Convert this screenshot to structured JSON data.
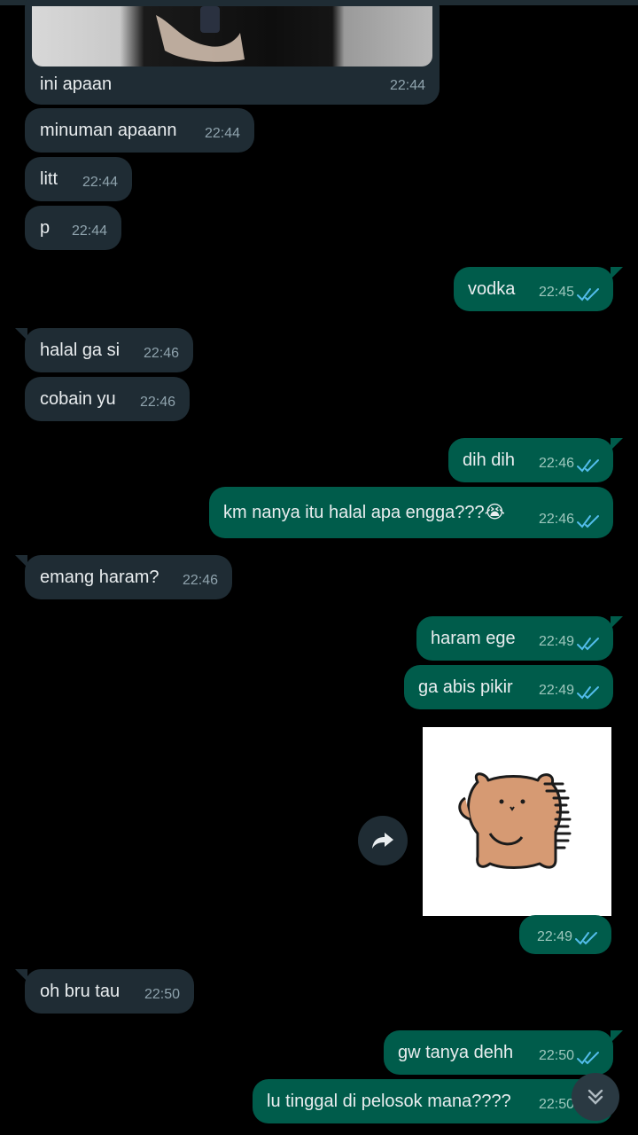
{
  "messages": [
    {
      "text": "ini apaan",
      "time": "22:44",
      "dir": "in"
    },
    {
      "text": "minuman apaann",
      "time": "22:44",
      "dir": "in"
    },
    {
      "text": "litt",
      "time": "22:44",
      "dir": "in"
    },
    {
      "text": "p",
      "time": "22:44",
      "dir": "in"
    },
    {
      "text": "vodka",
      "time": "22:45",
      "dir": "out"
    },
    {
      "text": "halal ga si",
      "time": "22:46",
      "dir": "in"
    },
    {
      "text": "cobain yu",
      "time": "22:46",
      "dir": "in"
    },
    {
      "text": "dih dih",
      "time": "22:46",
      "dir": "out"
    },
    {
      "text": "km nanya itu halal apa engga???😭",
      "time": "22:46",
      "dir": "out"
    },
    {
      "text": "emang haram?",
      "time": "22:46",
      "dir": "in"
    },
    {
      "text": "haram ege",
      "time": "22:49",
      "dir": "out"
    },
    {
      "text": "ga abis pikir",
      "time": "22:49",
      "dir": "out"
    },
    {
      "text": "",
      "time": "22:49",
      "dir": "out"
    },
    {
      "text": "oh bru tau",
      "time": "22:50",
      "dir": "in"
    },
    {
      "text": "gw tanya dehh",
      "time": "22:50",
      "dir": "out"
    },
    {
      "text": "lu tinggal di pelosok mana????",
      "time": "22:50",
      "dir": "out"
    }
  ],
  "colors": {
    "background": "#000000",
    "incoming_bubble": "#1f2c34",
    "outgoing_bubble": "#005c4b",
    "read_ticks": "#53bdeb"
  },
  "icons": {
    "read_receipt": "double-check-icon",
    "forward": "forward-arrow-icon",
    "scroll_down": "double-chevron-down-icon",
    "sticker": "brown-bear-sticker"
  }
}
